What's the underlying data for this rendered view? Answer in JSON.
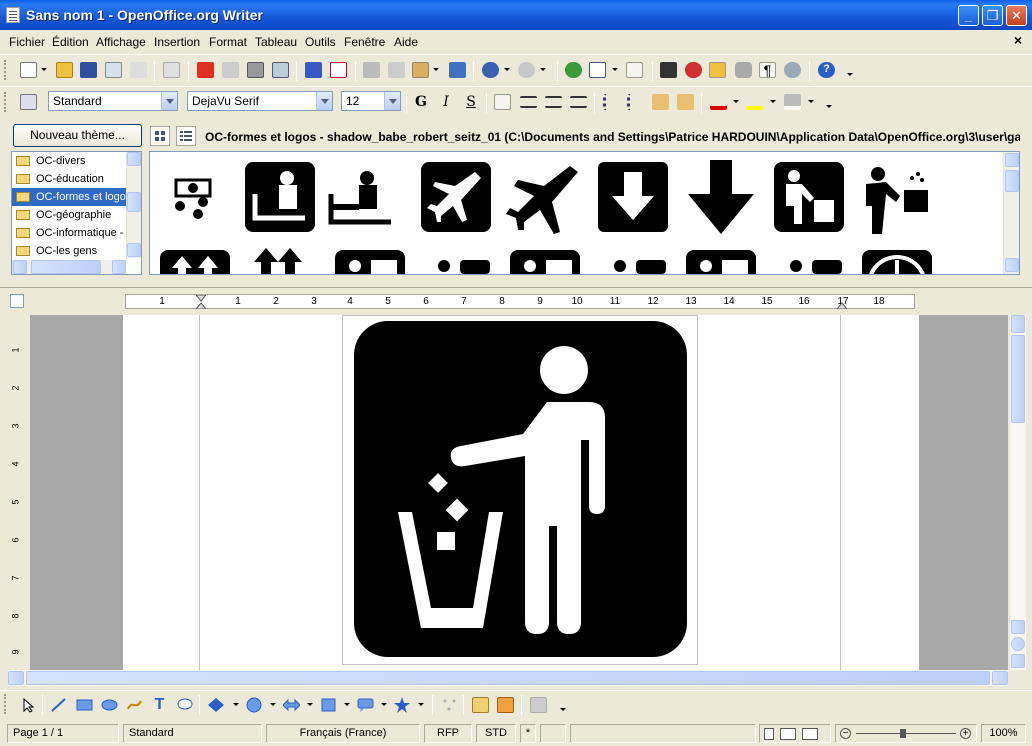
{
  "window": {
    "title": "Sans nom 1 - OpenOffice.org Writer",
    "minimize": "_",
    "maximize": "❐",
    "close": "✕"
  },
  "menu": {
    "items": [
      "Fichier",
      "Édition",
      "Affichage",
      "Insertion",
      "Format",
      "Tableau",
      "Outils",
      "Fenêtre",
      "Aide"
    ],
    "close_doc": "×"
  },
  "format_bar": {
    "paragraph_style": "Standard",
    "font_name": "DejaVu Serif",
    "font_size": "12",
    "bold": "G",
    "italic": "I",
    "underline": "S"
  },
  "gallery": {
    "new_theme_button": "Nouveau thème...",
    "themes": [
      "OC-divers",
      "OC-éducation",
      "OC-formes et logos",
      "OC-géographie",
      "OC-informatique -",
      "OC-les gens"
    ],
    "selected_theme": "OC-formes et logos",
    "path": "OC-formes et logos - shadow_babe_robert_seitz_01 (C:\\Documents and Settings\\Patrice HARDOUIN\\Application Data\\OpenOffice.org\\3\\user\\ga"
  },
  "ruler": {
    "numbers": [
      "1",
      "2",
      "1",
      "2",
      "3",
      "4",
      "5",
      "6",
      "7",
      "8",
      "9",
      "10",
      "11",
      "12",
      "13",
      "14",
      "15",
      "16",
      "17",
      "18"
    ],
    "vertical_numbers": [
      "1",
      "2",
      "3",
      "4",
      "5",
      "6",
      "7",
      "8",
      "9"
    ]
  },
  "statusbar": {
    "page": "Page 1 / 1",
    "page_style": "Standard",
    "language": "Français (France)",
    "mode_insert": "RFP",
    "selection_mode": "STD",
    "modified": "*",
    "zoom": "100%"
  },
  "colors": {
    "titlebar": "#0c47c1",
    "selection": "#316ac5",
    "chrome": "#ece9d8",
    "document_bg": "#a8a8a8"
  },
  "icons": {
    "document_image": "litter-disposal-pictogram"
  }
}
